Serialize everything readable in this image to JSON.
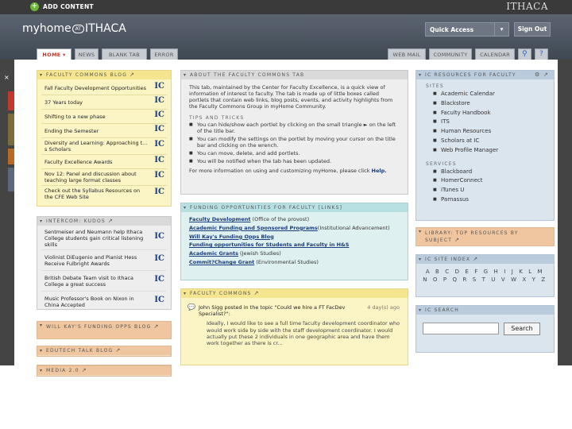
{
  "topbar": {
    "add_content": "ADD CONTENT",
    "institution": "ITHACA"
  },
  "header": {
    "logo_my": "myhome",
    "logo_at": "AT",
    "logo_ithaca": "ITHACA",
    "quick_access": "Quick Access",
    "sign_out": "Sign Out"
  },
  "tabs_left": [
    "HOME",
    "NEWS",
    "BLANK TAB",
    "ERROR"
  ],
  "tabs_right": [
    "WEB MAIL",
    "COMMUNITY",
    "CALENDAR"
  ],
  "icons": {
    "tab_link": "link-icon",
    "tab_help": "help-icon",
    "external": "external-link-icon",
    "collapse": "chevron-down-icon",
    "comment": "comment-bubble-icon",
    "close": "close-icon"
  },
  "colors": {
    "yellow": "#fbf4c5",
    "gray": "#eeeeee",
    "blue": "#dbe5ee",
    "teal": "#dff0f0",
    "orange": "#f6dcc0",
    "link": "#1a3d7c"
  },
  "left_edge_marker": "×",
  "faculty_blog": {
    "title": "FACULTY COMMONS BLOG",
    "items": [
      "Fall Faculty Development Opportunities",
      "37 Years today",
      "Shifting to a new phase",
      "Ending the Semester",
      "Diversity and Learning: Approaching t…s Scholars",
      "Faculty Excellence Awards",
      "Nov 12: Panel and discussion about teaching large format classes",
      "Check out the Syllabus Resources on the CFE Web Site"
    ],
    "badge": "IC"
  },
  "intercom": {
    "title": "INTERCOM: KUDOS",
    "items": [
      "Sentmeiser and Neumann help Ithaca College students gain critical listening skills",
      "Violinist DiEugenio and Pianist Hess Receive Fulbright Awards",
      "British Debate Team visit to Ithaca College a great success",
      "Music Professor's Book on Nixon in China Accepted"
    ]
  },
  "wills_blog": {
    "title": "WILL KAY'S FUNDING OPPS BLOG"
  },
  "edutech": {
    "title": "EDUTECH TALK BLOG"
  },
  "media": {
    "title": "MEDIA 2.0"
  },
  "about": {
    "title": "ABOUT THE FACULTY COMMONS TAB",
    "intro": "This tab, maintained by the Center for Faculty Excellence, is a quick view of information of interest to faculty. The tab is made up of little boxes called portlets that contain web links, blog posts, events, and activity highlights from the Faculty Commons Group in myHome Community.",
    "tips_title": "TIPS AND TRICKS",
    "tips": [
      "You can hide/show each portlet by clicking on the small triangle ► on the left of the title bar.",
      "You can modify the settings on the portlet by moving your cursor on the title bar and clicking on the wrench.",
      "You can move, delete, and add portlets.",
      "You will be notified when the tab has been updated."
    ],
    "more_info": "For more information on using and customizing myHome, please click",
    "help_link": "Help."
  },
  "funding": {
    "title": "FUNDING OPPORTUNITIES FOR FACULTY [LINKS]",
    "items": [
      {
        "link": "Faculty Development",
        "note": " (Office of the provost)"
      },
      {
        "link": "Academic Funding and Sponsored Programs",
        "note": "(Institutional Advancement)"
      },
      {
        "link": "Will Kay's Funding Opps Blog",
        "note": ""
      },
      {
        "link": "Funding opportunities for Students and Faculty in H&S",
        "note": ""
      },
      {
        "link": "Academic Grants",
        "note": " (Jewish Studies)"
      },
      {
        "link": "Commit?Change Grant",
        "note": " (Environmental Studies)"
      }
    ]
  },
  "commons": {
    "title": "FACULTY COMMONS",
    "who": "John Sigg posted in the topic \"Could we hire a FT FacDev Specialist?\":",
    "when": "4 day(s) ago",
    "excerpt": "Ideally, I would like to see a full time faculty development coordinator who would work side by side with the staff development coordinator. I would actually put these 2 individuals in one geographic area and have them work together as there is cr..."
  },
  "resources": {
    "title": "IC RESOURCES FOR FACULTY",
    "sites_label": "SITES",
    "sites": [
      "Academic Calendar",
      "Blackstore",
      "Faculty Handbook",
      "ITS",
      "Human Resources",
      "Scholars at IC",
      "Web Profile Manager"
    ],
    "services_label": "SERVICES",
    "services": [
      "Blackboard",
      "HomerConnect",
      "iTunes U",
      "Parnassus"
    ]
  },
  "library": {
    "title": "LIBRARY: TOP RESOURCES BY SUBJECT"
  },
  "site_index": {
    "title": "IC SITE INDEX",
    "letters": "A B C D E F G H I J K L M N O P Q R S T U V W X Y Z"
  },
  "ic_search": {
    "title": "IC SEARCH",
    "button": "Search"
  }
}
